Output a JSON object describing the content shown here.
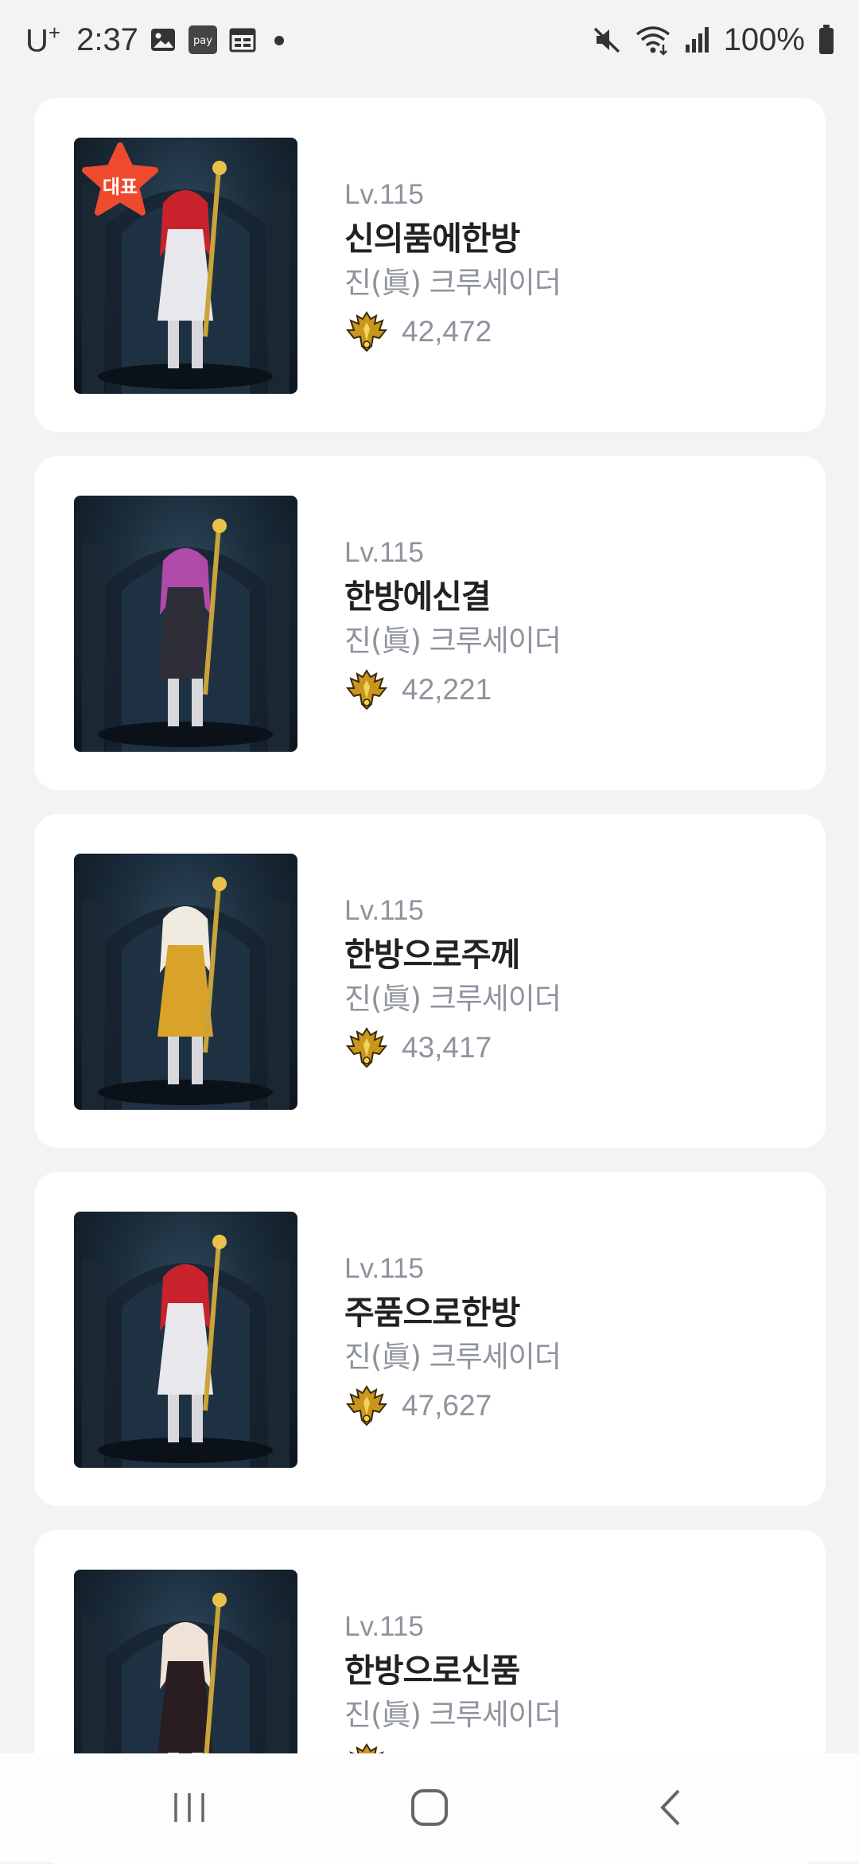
{
  "status_bar": {
    "carrier": "U",
    "carrier_sup": "+",
    "time": "2:37",
    "battery": "100%",
    "icons": [
      "gallery-icon",
      "pay-icon",
      "calendar-icon",
      "dot-icon",
      "mute-icon",
      "wifi-icon",
      "signal-icon",
      "battery-icon"
    ],
    "pay_label": "pay"
  },
  "characters": [
    {
      "level": "Lv.115",
      "name": "신의품에한방",
      "job": "진(眞) 크루세이더",
      "power": "42,472",
      "representative": true,
      "badge_label": "대표",
      "hair_color": "#c8232c",
      "outfit_color": "#e8e8ec"
    },
    {
      "level": "Lv.115",
      "name": "한방에신결",
      "job": "진(眞) 크루세이더",
      "power": "42,221",
      "representative": false,
      "hair_color": "#b04aa8",
      "outfit_color": "#2e2e38"
    },
    {
      "level": "Lv.115",
      "name": "한방으로주께",
      "job": "진(眞) 크루세이더",
      "power": "43,417",
      "representative": false,
      "hair_color": "#f0ebe0",
      "outfit_color": "#d9a32a"
    },
    {
      "level": "Lv.115",
      "name": "주품으로한방",
      "job": "진(眞) 크루세이더",
      "power": "47,627",
      "representative": false,
      "hair_color": "#c8232c",
      "outfit_color": "#e8e8ec"
    },
    {
      "level": "Lv.115",
      "name": "한방으로신품",
      "job": "진(眞) 크루세이더",
      "power": "",
      "representative": false,
      "hair_color": "#efe2d6",
      "outfit_color": "#2a1d22"
    }
  ],
  "nav": {
    "icons": [
      "recent-apps-icon",
      "home-icon",
      "back-icon"
    ]
  }
}
